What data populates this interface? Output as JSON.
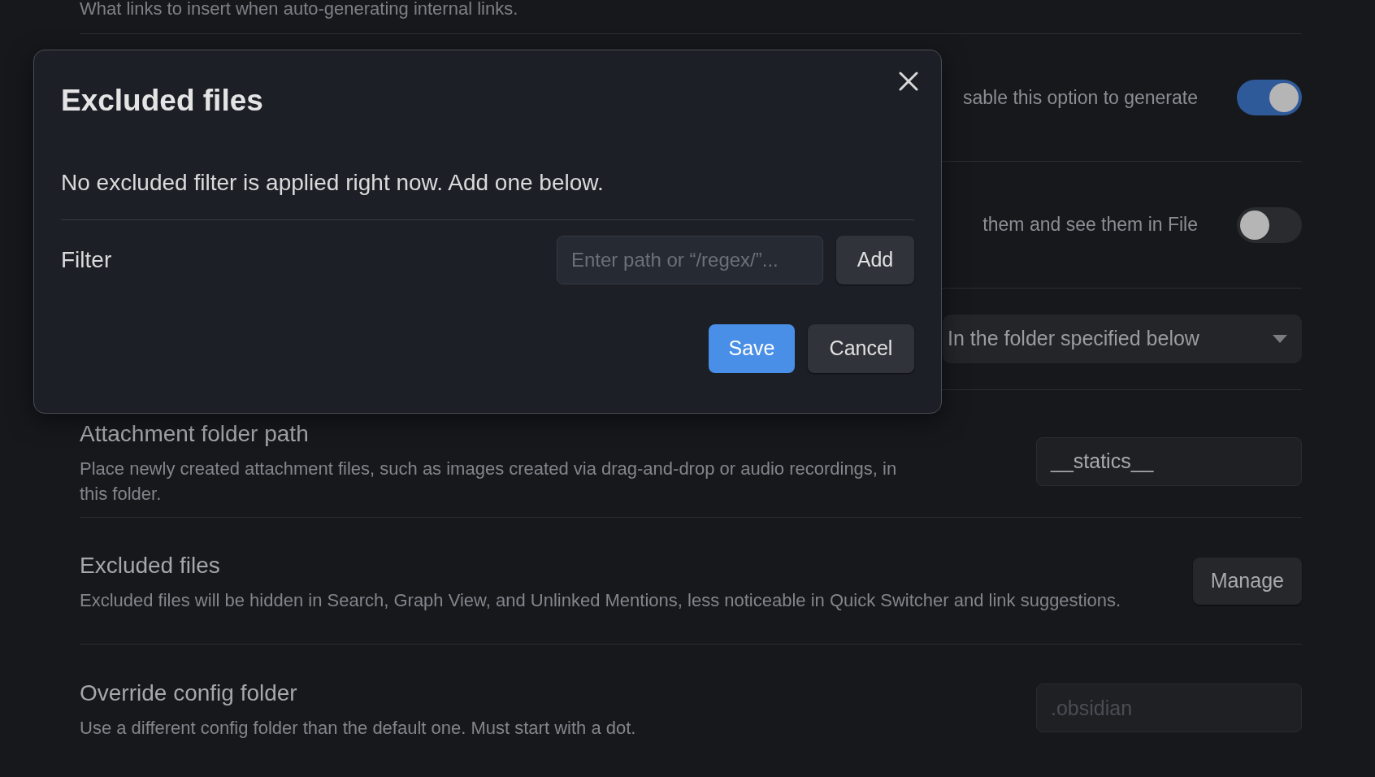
{
  "settings": [
    {
      "kind": "text",
      "description": "What links to insert when auto-generating internal links."
    },
    {
      "kind": "toggle",
      "description": "sable this option to generate",
      "on": true
    },
    {
      "kind": "toggle",
      "description": "them and see them in File",
      "on": false
    },
    {
      "kind": "dropdown",
      "value": "In the folder specified below"
    },
    {
      "kind": "field",
      "title": "Attachment folder path",
      "description": "Place newly created attachment files, such as images created via drag-and-drop or audio recordings, in this folder.",
      "value": "__statics__"
    },
    {
      "kind": "button",
      "title": "Excluded files",
      "description": "Excluded files will be hidden in Search, Graph View, and Unlinked Mentions, less noticeable in Quick Switcher and link suggestions.",
      "button": "Manage"
    },
    {
      "kind": "field",
      "title": "Override config folder",
      "description": "Use a different config folder than the default one. Must start with a dot.",
      "placeholder": ".obsidian"
    }
  ],
  "dialog": {
    "title": "Excluded files",
    "message": "No excluded filter is applied right now. Add one below.",
    "filter_label": "Filter",
    "filter_placeholder": "Enter path or “/regex/”...",
    "add_button": "Add",
    "save_button": "Save",
    "cancel_button": "Cancel"
  }
}
